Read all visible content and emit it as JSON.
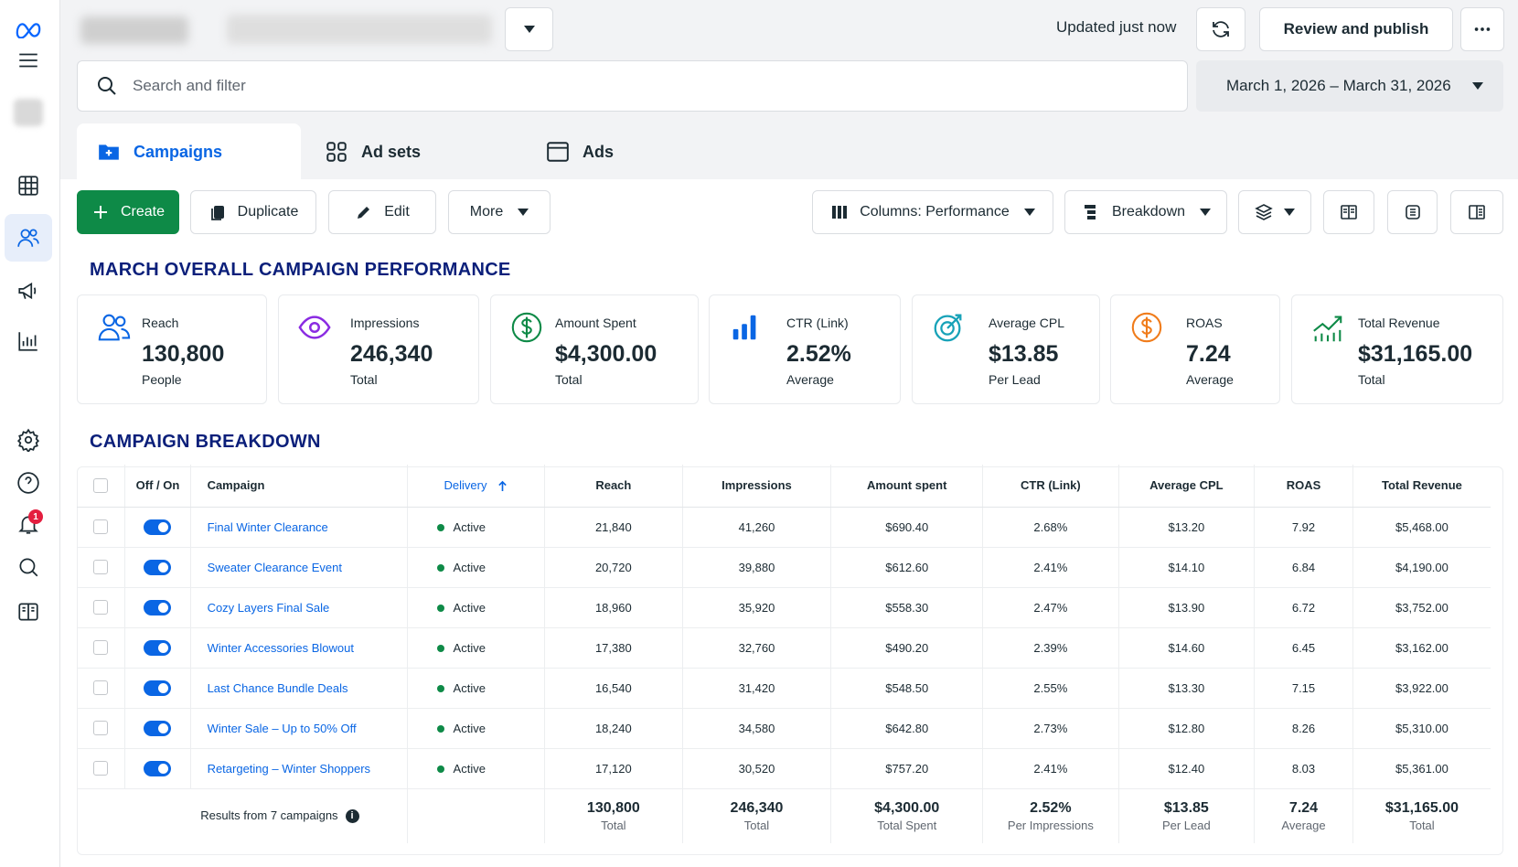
{
  "header": {
    "updated_text": "Updated just now",
    "review_publish_label": "Review and publish",
    "more_icon": "ellipsis-icon"
  },
  "search": {
    "placeholder": "Search and filter"
  },
  "date_range": {
    "label": "March 1, 2026 – March 31, 2026"
  },
  "tabs": [
    {
      "label": "Campaigns",
      "icon": "campaign-folder-icon"
    },
    {
      "label": "Ad sets",
      "icon": "grid-icon"
    },
    {
      "label": "Ads",
      "icon": "ad-window-icon"
    }
  ],
  "toolbar": {
    "create_label": "Create",
    "duplicate_label": "Duplicate",
    "edit_label": "Edit",
    "more_label": "More",
    "columns_label": "Columns: Performance",
    "breakdown_label": "Breakdown"
  },
  "overview": {
    "title": "MARCH OVERALL CAMPAIGN PERFORMANCE",
    "kpis": [
      {
        "label": "Reach",
        "value": "130,800",
        "sub": "People",
        "icon": "people-icon",
        "color": "#0a66e4"
      },
      {
        "label": "Impressions",
        "value": "246,340",
        "sub": "Total",
        "icon": "eye-icon",
        "color": "#8a2be2"
      },
      {
        "label": "Amount Spent",
        "value": "$4,300.00",
        "sub": "Total",
        "icon": "dollar-circle-icon",
        "color": "#0e8a47"
      },
      {
        "label": "CTR (Link)",
        "value": "2.52%",
        "sub": "Average",
        "icon": "bar-chart-icon",
        "color": "#0a66e4"
      },
      {
        "label": "Average CPL",
        "value": "$13.85",
        "sub": "Per Lead",
        "icon": "target-icon",
        "color": "#17a2b8"
      },
      {
        "label": "ROAS",
        "value": "7.24",
        "sub": "Average",
        "icon": "coin-icon",
        "color": "#f07c1b"
      },
      {
        "label": "Total Revenue",
        "value": "$31,165.00",
        "sub": "Total",
        "icon": "trend-up-icon",
        "color": "#0e8a47"
      }
    ]
  },
  "breakdown": {
    "title": "CAMPAIGN BREAKDOWN",
    "columns": [
      "Off / On",
      "Campaign",
      "Delivery",
      "Reach",
      "Impressions",
      "Amount spent",
      "CTR (Link)",
      "Average CPL",
      "ROAS",
      "Total Revenue"
    ],
    "rows": [
      {
        "campaign": "Final Winter Clearance",
        "delivery": "Active",
        "reach": "21,840",
        "impressions": "41,260",
        "spent": "$690.40",
        "ctr": "2.68%",
        "cpl": "$13.20",
        "roas": "7.92",
        "revenue": "$5,468.00",
        "on": true
      },
      {
        "campaign": "Sweater Clearance Event",
        "delivery": "Active",
        "reach": "20,720",
        "impressions": "39,880",
        "spent": "$612.60",
        "ctr": "2.41%",
        "cpl": "$14.10",
        "roas": "6.84",
        "revenue": "$4,190.00",
        "on": true
      },
      {
        "campaign": "Cozy Layers Final Sale",
        "delivery": "Active",
        "reach": "18,960",
        "impressions": "35,920",
        "spent": "$558.30",
        "ctr": "2.47%",
        "cpl": "$13.90",
        "roas": "6.72",
        "revenue": "$3,752.00",
        "on": true
      },
      {
        "campaign": "Winter Accessories Blowout",
        "delivery": "Active",
        "reach": "17,380",
        "impressions": "32,760",
        "spent": "$490.20",
        "ctr": "2.39%",
        "cpl": "$14.60",
        "roas": "6.45",
        "revenue": "$3,162.00",
        "on": true
      },
      {
        "campaign": "Last Chance Bundle Deals",
        "delivery": "Active",
        "reach": "16,540",
        "impressions": "31,420",
        "spent": "$548.50",
        "ctr": "2.55%",
        "cpl": "$13.30",
        "roas": "7.15",
        "revenue": "$3,922.00",
        "on": true
      },
      {
        "campaign": "Winter Sale – Up to 50% Off",
        "delivery": "Active",
        "reach": "18,240",
        "impressions": "34,580",
        "spent": "$642.80",
        "ctr": "2.73%",
        "cpl": "$12.80",
        "roas": "8.26",
        "revenue": "$5,310.00",
        "on": true
      },
      {
        "campaign": "Retargeting – Winter Shoppers",
        "delivery": "Active",
        "reach": "17,120",
        "impressions": "30,520",
        "spent": "$757.20",
        "ctr": "2.41%",
        "cpl": "$12.40",
        "roas": "8.03",
        "revenue": "$5,361.00",
        "on": true
      }
    ],
    "totals": {
      "results_label": "Results from 7 campaigns",
      "reach": {
        "value": "130,800",
        "label": "Total"
      },
      "impressions": {
        "value": "246,340",
        "label": "Total"
      },
      "spent": {
        "value": "$4,300.00",
        "label": "Total Spent"
      },
      "ctr": {
        "value": "2.52%",
        "label": "Per Impressions"
      },
      "cpl": {
        "value": "$13.85",
        "label": "Per Lead"
      },
      "roas": {
        "value": "7.24",
        "label": "Average"
      },
      "revenue": {
        "value": "$31,165.00",
        "label": "Total"
      }
    }
  },
  "notifications": {
    "badge": "1"
  }
}
